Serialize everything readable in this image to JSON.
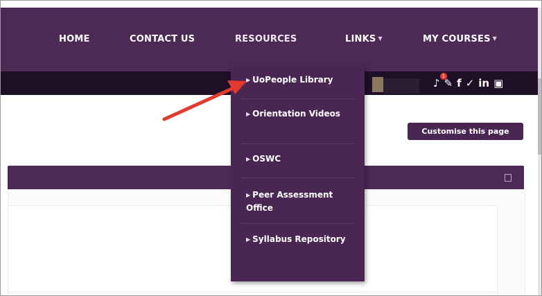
{
  "nav": {
    "home": "HOME",
    "contact": "CONTACT US",
    "resources": "RESOURCES",
    "links": "LINKS",
    "my_courses": "MY COURSES"
  },
  "toolbar_icons": [
    "bell-icon",
    "chat-icon",
    "facebook-icon",
    "twitter-icon",
    "linkedin-icon",
    "youtube-icon"
  ],
  "notification_count": "1",
  "customise_button": "Customise this page",
  "dropdown": {
    "items": [
      {
        "label": "UoPeople Library"
      },
      {
        "label": "Orientation Videos"
      },
      {
        "label": "OSWC"
      },
      {
        "label": "Peer Assessment Office"
      },
      {
        "label": "Syllabus Repository"
      }
    ]
  },
  "colors": {
    "nav_purple": "#4c2a55",
    "dark_bar": "#1f0f26",
    "dropdown_bg": "#4a2753",
    "arrow_red": "#e23b2e"
  }
}
